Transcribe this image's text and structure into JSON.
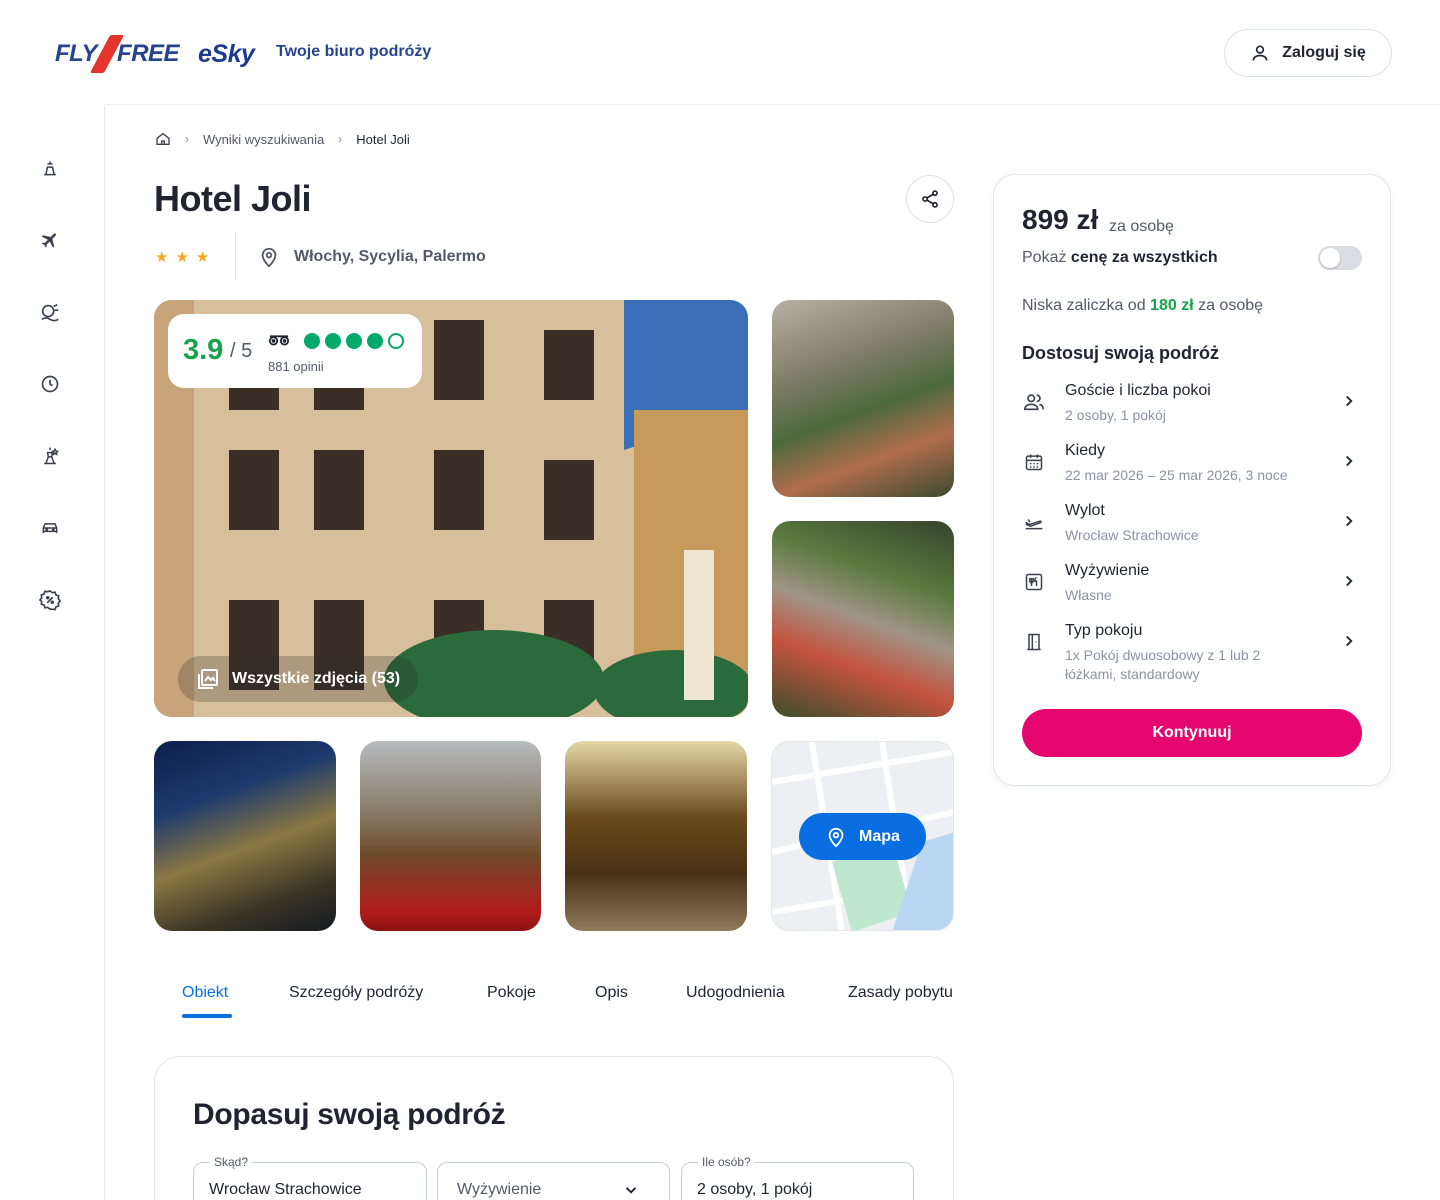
{
  "header": {
    "logo_fly_left": "FLY",
    "logo_fly_right": "FREE",
    "logo_esky": "eSky",
    "tagline": "Twoje biuro podróży",
    "login_label": "Zaloguj się"
  },
  "sidebar": {
    "items": [
      {
        "icon": "beach-icon"
      },
      {
        "icon": "plane-icon"
      },
      {
        "icon": "island-icon"
      },
      {
        "icon": "clock-icon"
      },
      {
        "icon": "landmark-icon"
      },
      {
        "icon": "car-icon"
      },
      {
        "icon": "discount-icon"
      }
    ]
  },
  "breadcrumb": {
    "home_icon": "home-icon",
    "search_results": "Wyniki wyszukiwania",
    "current": "Hotel Joli"
  },
  "hotel": {
    "name": "Hotel Joli",
    "stars": 3,
    "location": "Włochy, Sycylia, Palermo"
  },
  "rating": {
    "score": "3.9",
    "out_of": "/ 5",
    "bubbles_filled": 4,
    "bubbles_total": 5,
    "reviews": "881 opinii"
  },
  "gallery": {
    "all_photos": "Wszystkie zdjęcia (53)",
    "map_label": "Mapa"
  },
  "tabs": [
    "Obiekt",
    "Szczegóły podróży",
    "Pokoje",
    "Opis",
    "Udogodnienia",
    "Zasady pobytu"
  ],
  "price_card": {
    "price": "899 zł",
    "per": "za osobę",
    "show_total_prefix": "Pokaż ",
    "show_total_bold": "cenę za wszystkich",
    "deposit_prefix": "Niska zaliczka od ",
    "deposit_amount": "180 zł",
    "deposit_suffix": " za osobę",
    "customize_title": "Dostosuj swoją podróż",
    "options": [
      {
        "title": "Goście i liczba pokoi",
        "sub": "2 osoby, 1 pokój",
        "icon": "users-icon"
      },
      {
        "title": "Kiedy",
        "sub": "22 mar 2026 – 25 mar 2026, 3 noce",
        "icon": "calendar-icon"
      },
      {
        "title": "Wylot",
        "sub": "Wrocław Strachowice",
        "icon": "departure-icon"
      },
      {
        "title": "Wyżywienie",
        "sub": "Własne",
        "icon": "meal-icon"
      },
      {
        "title": "Typ pokoju",
        "sub": "1x Pokój dwuosobowy z 1 lub 2 łóżkami, standardowy",
        "icon": "door-icon"
      }
    ],
    "continue_label": "Kontynuuj"
  },
  "adjust": {
    "title": "Dopasuj swoją podróż",
    "from_label": "Skąd?",
    "from_value": "Wrocław Strachowice",
    "meal_placeholder": "Wyżywienie",
    "people_label": "Ile osób?",
    "people_value": "2 osoby, 1 pokój"
  },
  "colors": {
    "accent_blue": "#0a6ee3",
    "cta_pink": "#e6066f",
    "rating_green": "#16a34a",
    "star_gold": "#f5a623"
  }
}
